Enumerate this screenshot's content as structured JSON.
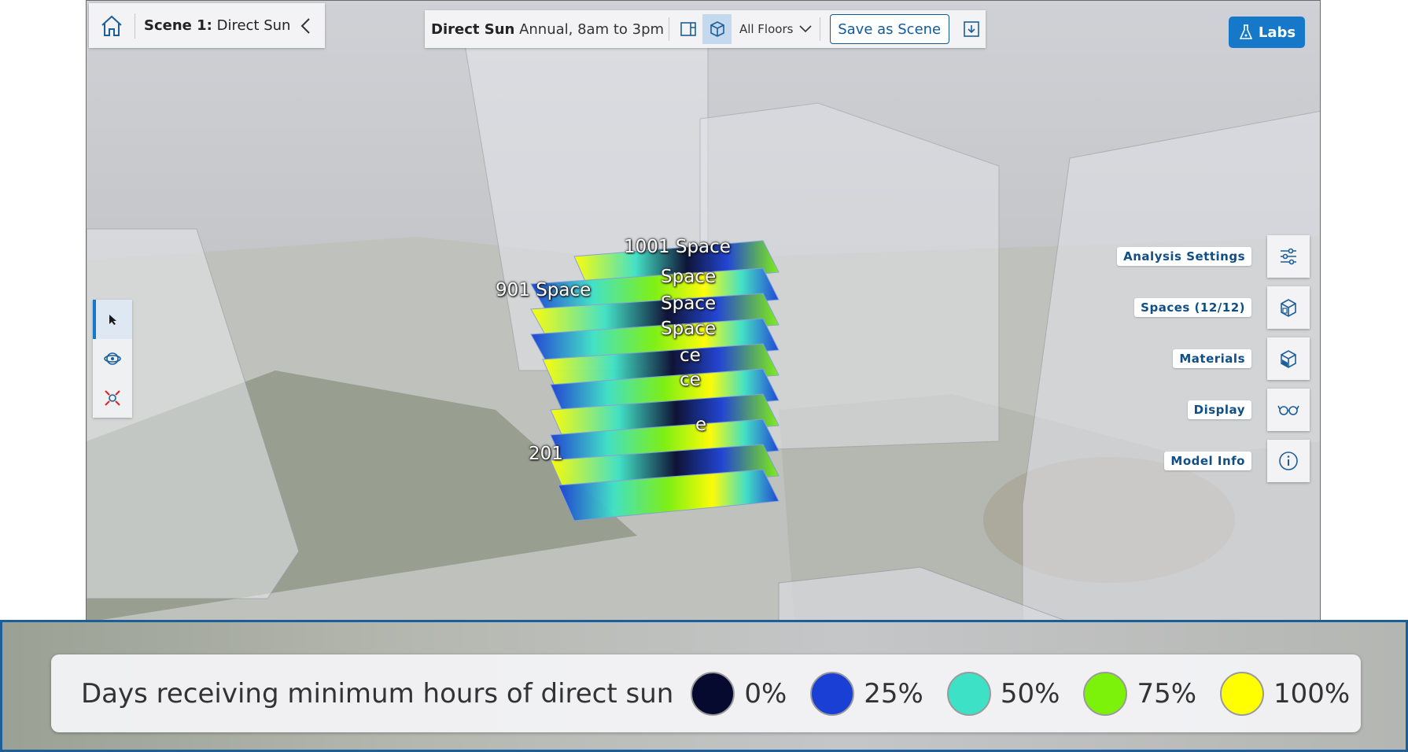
{
  "breadcrumb": {
    "scene_prefix": "Scene 1:",
    "scene_name": "Direct Sun"
  },
  "toolbar": {
    "analysis_name": "Direct Sun",
    "analysis_detail": "Annual, 8am to 3pm",
    "floors_select": "All Floors",
    "save_label": "Save as Scene"
  },
  "labs_label": "Labs",
  "right_panel": {
    "analysis_settings": "Analysis Settings",
    "spaces": "Spaces (12/12)",
    "materials": "Materials",
    "display": "Display",
    "model_info": "Model Info"
  },
  "floor_labels": {
    "f1001": "1001 Space",
    "f901": "901 Space",
    "f801": "Space",
    "f701": "Space",
    "f601": "Space",
    "f501": "ce",
    "f401": "ce",
    "f301": "e",
    "f201": "201"
  },
  "legend": {
    "title": "Days receiving minimum hours of direct sun",
    "items": [
      {
        "label": "0%",
        "color": "#050a2e"
      },
      {
        "label": "25%",
        "color": "#1a3fd4"
      },
      {
        "label": "50%",
        "color": "#3de2c6"
      },
      {
        "label": "75%",
        "color": "#7cf20a"
      },
      {
        "label": "100%",
        "color": "#ffff00"
      }
    ]
  },
  "colors": {
    "accent": "#1578c9",
    "brand_text": "#0f4f86"
  }
}
